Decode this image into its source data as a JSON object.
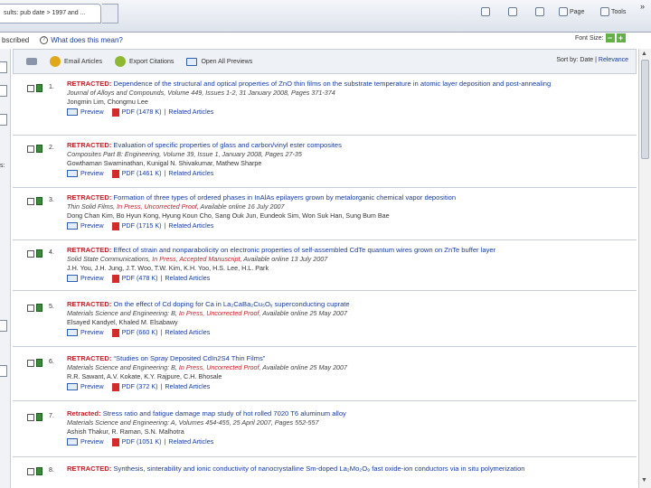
{
  "browser": {
    "tab_title": "sults: pub date > 1997 and ...",
    "commands": [
      "Page",
      "Tools"
    ],
    "chevron": "»"
  },
  "subbar": {
    "subscribed": "bscribed",
    "what_link": "What does this mean?",
    "font_size_label": "Font Size:",
    "minus": "−",
    "plus": "+"
  },
  "leftstrip": {
    "labels": [
      "s:"
    ]
  },
  "toolbar": {
    "email": "Email Articles",
    "export": "Export Citations",
    "open_previews": "Open All Previews",
    "sort_by": "Sort by:",
    "sort_date": "Date",
    "sort_sep": "|",
    "sort_relevance": "Relevance"
  },
  "links": {
    "preview": "Preview",
    "related": "Related Articles",
    "sep": "|"
  },
  "results": [
    {
      "num": "1.",
      "prefix": "RETRACTED:",
      "title": "Dependence of the structural and optical properties of ZnO thin films on the substrate temperature in atomic layer deposition and post-annealing",
      "journal": "Journal of Alloys and Compounds, Volume 449, Issues 1-2, 31 January 2008, Pages 371-374",
      "press": "",
      "journal_tail": "",
      "authors": "Jongmin Lim, Chongmu Lee",
      "pdf": "PDF (1478 K)"
    },
    {
      "num": "2.",
      "prefix": "RETRACTED:",
      "title": "Evaluation of specific properties of glass and carbon/vinyl ester composites",
      "journal": "Composites Part B: Engineering, Volume 39, Issue 1, January 2008, Pages 27-35",
      "press": "",
      "journal_tail": "",
      "authors": "Gowthaman Swaminathan, Kunigal N. Shivakumar, Mathew Sharpe",
      "pdf": "PDF (1461 K)"
    },
    {
      "num": "3.",
      "prefix": "RETRACTED:",
      "title": "Formation of three types of ordered phases in InAlAs epilayers grown by metalorganic chemical vapor deposition",
      "journal": "Thin Solid Films,",
      "press": "In Press, Uncorrected Proof,",
      "journal_tail": "Available online 16 July 2007",
      "authors": "Dong Chan Kim, Bo Hyun Kong, Hyung Koun Cho, Sang Ouk Jun, Eundeok Sim, Won Suk Han, Sung Bum Bae",
      "pdf": "PDF (1715 K)"
    },
    {
      "num": "4.",
      "prefix": "RETRACTED:",
      "title": "Effect of strain and nonparabolicity on electronic properties of self-assembled CdTe quantum wires grown on ZnTe buffer layer",
      "journal": "Solid State Communications,",
      "press": "In Press, Accepted Manuscript,",
      "journal_tail": "Available online 13 July 2007",
      "authors": "J.H. You, J.H. Jung, J.T. Woo, T.W. Kim, K.H. Yoo, H.S. Lee, H.L. Park",
      "pdf": "PDF (478 K)"
    },
    {
      "num": "5.",
      "prefix": "RETRACTED:",
      "title": "On the effect of Cd doping for Ca in La₂CaBa₂Cu₅Oᵧ superconducting cuprate",
      "journal": "Materials Science and Engineering: B,",
      "press": "In Press, Uncorrected Proof,",
      "journal_tail": "Available online 25 May 2007",
      "authors": "Elsayed Kandyel, Khaled M. Elsabawy",
      "pdf": "PDF (660 K)"
    },
    {
      "num": "6.",
      "prefix": "RETRACTED:",
      "title": "“Studies on Spray Deposited CdIn2S4 Thin Films”",
      "journal": "Materials Science and Engineering: B,",
      "press": "In Press, Uncorrected Proof,",
      "journal_tail": "Available online 25 May 2007",
      "authors": "R.R. Sawant, A.V. Kokate, K.Y. Rajpure, C.H. Bhosale",
      "pdf": "PDF (372 K)"
    },
    {
      "num": "7.",
      "prefix": "Retracted:",
      "title": "Stress ratio and fatigue damage map study of hot rolled 7020 T6 aluminum alloy",
      "journal": "Materials Science and Engineering: A, Volumes 454-455, 25 April 2007, Pages 552-557",
      "press": "",
      "journal_tail": "",
      "authors": "Ashish Thakur, R. Raman, S.N. Malhotra",
      "pdf": "PDF (1051 K)"
    },
    {
      "num": "8.",
      "prefix": "RETRACTED:",
      "title": "Synthesis, sinterability and ionic conductivity of nanocrystalline Sm-doped La₂Mo₂O₉ fast oxide-ion conductors via in situ polymerization",
      "journal": "",
      "press": "",
      "journal_tail": "",
      "authors": "",
      "pdf": ""
    }
  ]
}
